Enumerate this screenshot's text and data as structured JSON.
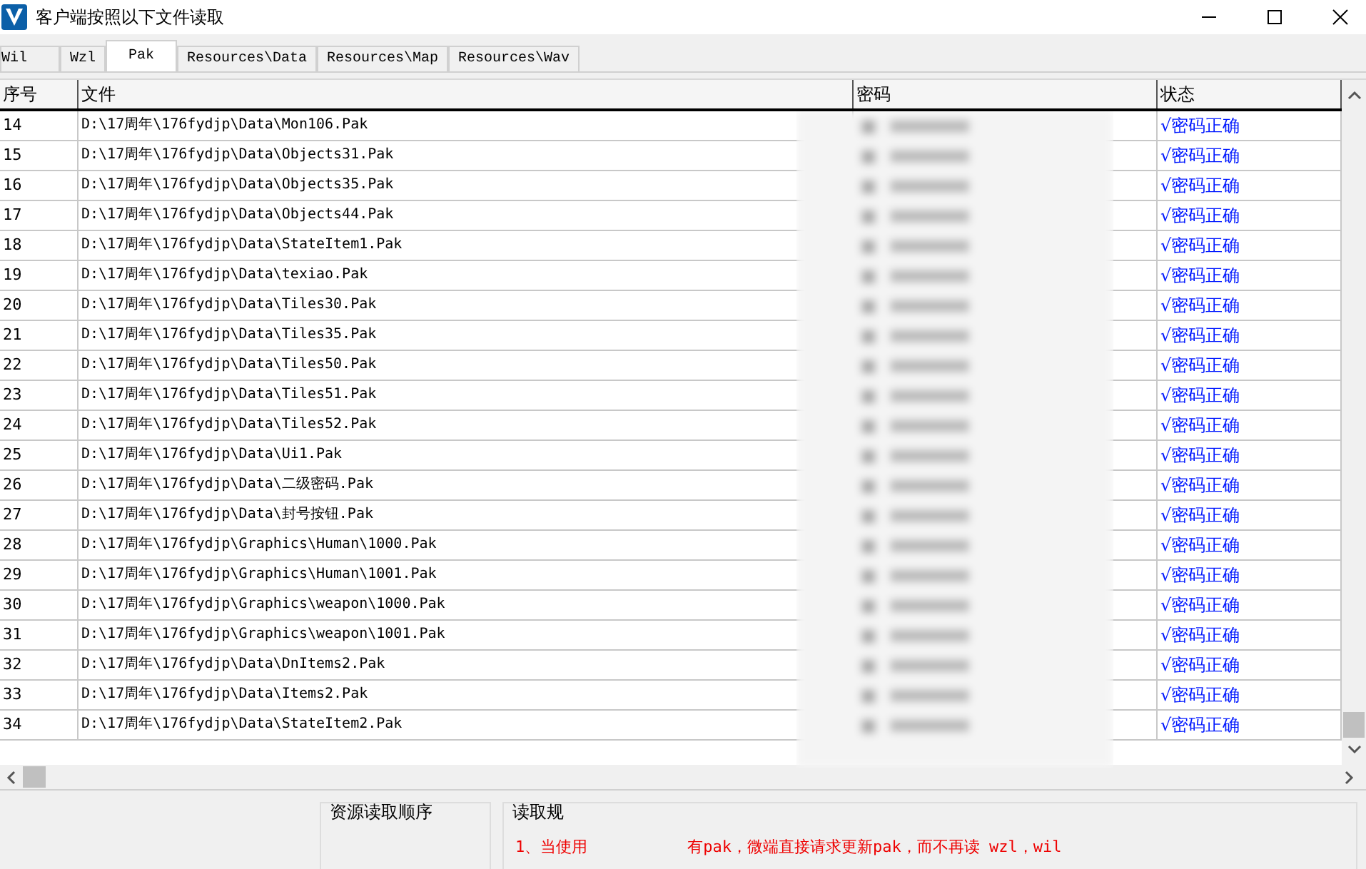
{
  "window": {
    "title": "客户端按照以下文件读取"
  },
  "tabs": [
    {
      "label": "Wil",
      "selected": false
    },
    {
      "label": "Wzl",
      "selected": false
    },
    {
      "label": "Pak",
      "selected": true
    },
    {
      "label": "Resources\\Data",
      "selected": false
    },
    {
      "label": "Resources\\Map",
      "selected": false
    },
    {
      "label": "Resources\\Wav",
      "selected": false
    }
  ],
  "table": {
    "columns": [
      "序号",
      "文件",
      "密码",
      "状态"
    ],
    "rows": [
      {
        "index": "14",
        "file": "D:\\17周年\\176fydjp\\Data\\Mon106.Pak",
        "status": "√密码正确"
      },
      {
        "index": "15",
        "file": "D:\\17周年\\176fydjp\\Data\\Objects31.Pak",
        "status": "√密码正确"
      },
      {
        "index": "16",
        "file": "D:\\17周年\\176fydjp\\Data\\Objects35.Pak",
        "status": "√密码正确"
      },
      {
        "index": "17",
        "file": "D:\\17周年\\176fydjp\\Data\\Objects44.Pak",
        "status": "√密码正确"
      },
      {
        "index": "18",
        "file": "D:\\17周年\\176fydjp\\Data\\StateItem1.Pak",
        "status": "√密码正确"
      },
      {
        "index": "19",
        "file": "D:\\17周年\\176fydjp\\Data\\texiao.Pak",
        "status": "√密码正确"
      },
      {
        "index": "20",
        "file": "D:\\17周年\\176fydjp\\Data\\Tiles30.Pak",
        "status": "√密码正确"
      },
      {
        "index": "21",
        "file": "D:\\17周年\\176fydjp\\Data\\Tiles35.Pak",
        "status": "√密码正确"
      },
      {
        "index": "22",
        "file": "D:\\17周年\\176fydjp\\Data\\Tiles50.Pak",
        "status": "√密码正确"
      },
      {
        "index": "23",
        "file": "D:\\17周年\\176fydjp\\Data\\Tiles51.Pak",
        "status": "√密码正确"
      },
      {
        "index": "24",
        "file": "D:\\17周年\\176fydjp\\Data\\Tiles52.Pak",
        "status": "√密码正确"
      },
      {
        "index": "25",
        "file": "D:\\17周年\\176fydjp\\Data\\Ui1.Pak",
        "status": "√密码正确"
      },
      {
        "index": "26",
        "file": "D:\\17周年\\176fydjp\\Data\\二级密码.Pak",
        "status": "√密码正确"
      },
      {
        "index": "27",
        "file": "D:\\17周年\\176fydjp\\Data\\封号按钮.Pak",
        "status": "√密码正确"
      },
      {
        "index": "28",
        "file": "D:\\17周年\\176fydjp\\Graphics\\Human\\1000.Pak",
        "status": "√密码正确"
      },
      {
        "index": "29",
        "file": "D:\\17周年\\176fydjp\\Graphics\\Human\\1001.Pak",
        "status": "√密码正确"
      },
      {
        "index": "30",
        "file": "D:\\17周年\\176fydjp\\Graphics\\weapon\\1000.Pak",
        "status": "√密码正确"
      },
      {
        "index": "31",
        "file": "D:\\17周年\\176fydjp\\Graphics\\weapon\\1001.Pak",
        "status": "√密码正确"
      },
      {
        "index": "32",
        "file": "D:\\17周年\\176fydjp\\Data\\DnItems2.Pak",
        "status": "√密码正确"
      },
      {
        "index": "33",
        "file": "D:\\17周年\\176fydjp\\Data\\Items2.Pak",
        "status": "√密码正确"
      },
      {
        "index": "34",
        "file": "D:\\17周年\\176fydjp\\Data\\StateItem2.Pak",
        "status": "√密码正确"
      }
    ]
  },
  "order_group": {
    "title": "资源读取顺序"
  },
  "rules_group": {
    "title": "读取规",
    "lines": [
      "1、当使用",
      "有pak，微端直接请求更新pak，而不再读 wzl，wil"
    ]
  }
}
